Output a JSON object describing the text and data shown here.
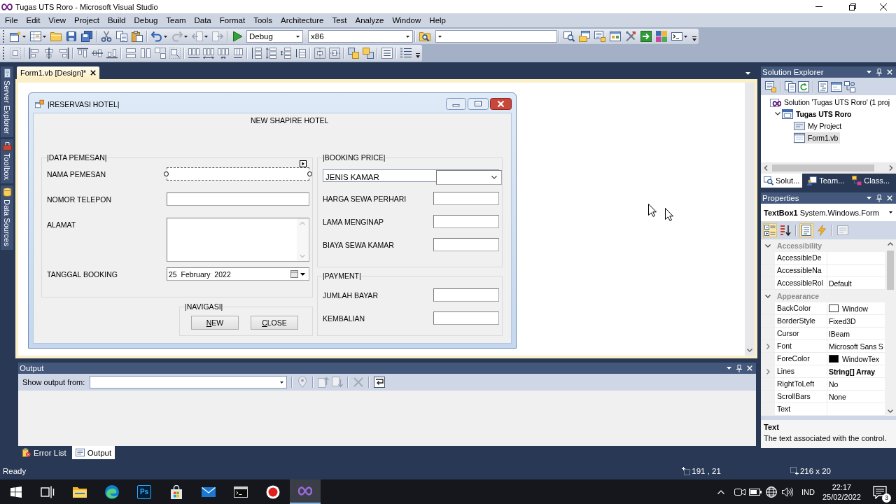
{
  "window": {
    "title": "Tugas UTS Roro - Microsoft Visual Studio"
  },
  "menu": [
    "File",
    "Edit",
    "View",
    "Project",
    "Build",
    "Debug",
    "Team",
    "Data",
    "Format",
    "Tools",
    "Architecture",
    "Test",
    "Analyze",
    "Window",
    "Help"
  ],
  "toolbar": {
    "configuration": "Debug",
    "platform": "x86"
  },
  "side_tabs": [
    "Server Explorer",
    "Toolbox",
    "Data Sources"
  ],
  "document_tabs": [
    {
      "label": "Form1.vb [Design]*",
      "selected": true
    }
  ],
  "form": {
    "title": "|RESERVASI HOTEL|",
    "heading": "NEW SHAPIRE HOTEL",
    "columns": [
      {
        "groups": [
          {
            "title": "|DATA PEMESAN|",
            "fields": [
              {
                "label": "NAMA PEMESAN",
                "kind": "textbox",
                "selected": true
              },
              {
                "label": "NOMOR TELEPON",
                "kind": "textbox",
                "selected": false
              },
              {
                "label": "ALAMAT",
                "kind": "multiline",
                "selected": false
              },
              {
                "label": "TANGGAL BOOKING",
                "kind": "date",
                "value": "25  February  2022",
                "selected": false
              }
            ]
          },
          {
            "title": "|NAVIGASI|",
            "buttons": [
              "NEW",
              "CLOSE"
            ]
          }
        ]
      },
      {
        "groups": [
          {
            "title": "|BOOKING PRICE|",
            "fields": [
              {
                "label": "JENIS KAMAR",
                "kind": "combo",
                "selected": false
              },
              {
                "label": "HARGA SEWA PERHARI",
                "kind": "textbox",
                "selected": false
              },
              {
                "label": "LAMA MENGINAP",
                "kind": "textbox",
                "selected": false
              },
              {
                "label": "BIAYA SEWA KAMAR",
                "kind": "textbox",
                "selected": false
              }
            ]
          },
          {
            "title": "|PAYMENT|",
            "fields": [
              {
                "label": "JUMLAH BAYAR",
                "kind": "textbox",
                "selected": false
              },
              {
                "label": "KEMBALIAN",
                "kind": "textbox",
                "selected": false
              }
            ]
          }
        ]
      }
    ]
  },
  "solution_explorer": {
    "title": "Solution Explorer",
    "tree": [
      {
        "label": "Solution 'Tugas UTS Roro' (1 proj",
        "kind": "solution",
        "selected": false,
        "children": [
          {
            "label": "Tugas UTS Roro",
            "kind": "project",
            "expanded": true,
            "selected": false,
            "children": [
              {
                "label": "My Project",
                "kind": "properties",
                "selected": false
              },
              {
                "label": "Form1.vb",
                "kind": "form",
                "selected": true
              }
            ]
          }
        ]
      }
    ],
    "tabs": [
      {
        "label": "Solut...",
        "kind": "solution",
        "selected": true
      },
      {
        "label": "Team...",
        "kind": "team",
        "selected": false
      },
      {
        "label": "Class...",
        "kind": "class",
        "selected": false
      }
    ]
  },
  "properties": {
    "title": "Properties",
    "object": "**TextBox1** System.Windows.Form",
    "view_buttons": [
      {
        "kind": "categorized",
        "selected": true
      },
      {
        "kind": "alphabetical",
        "selected": false
      },
      {
        "kind": "properties",
        "selected": true
      },
      {
        "kind": "events",
        "selected": false
      }
    ],
    "categories": [
      {
        "name": "Accessibility",
        "expanded": true,
        "rows": [
          {
            "name": "AccessibleDe",
            "expandable": false
          },
          {
            "name": "AccessibleNa",
            "expandable": false
          },
          {
            "name": "AccessibleRol",
            "value": "Default",
            "expandable": false,
            "modified": false
          }
        ]
      },
      {
        "name": "Appearance",
        "expanded": true,
        "rows": [
          {
            "name": "BackColor",
            "value": "Window",
            "color": "#ffffff",
            "expandable": false,
            "modified": false
          },
          {
            "name": "BorderStyle",
            "value": "Fixed3D",
            "expandable": false,
            "modified": false
          },
          {
            "name": "Cursor",
            "value": "IBeam",
            "expandable": false,
            "modified": false
          },
          {
            "name": "Font",
            "value": "Microsoft Sans S",
            "expandable": true,
            "modified": false
          },
          {
            "name": "ForeColor",
            "value": "WindowTex",
            "color": "#000000",
            "expandable": false,
            "modified": false
          },
          {
            "name": "Lines",
            "value": "String[] Array",
            "expandable": true,
            "modified": true
          },
          {
            "name": "RightToLeft",
            "value": "No",
            "expandable": false,
            "modified": false
          },
          {
            "name": "ScrollBars",
            "value": "None",
            "expandable": false,
            "modified": false
          },
          {
            "name": "Text",
            "expandable": false
          }
        ]
      }
    ],
    "description": {
      "title": "Text",
      "text": "The text associated with the control."
    }
  },
  "output": {
    "title": "Output",
    "show_label": "Show output from:"
  },
  "bottom_tabs": [
    {
      "label": "Error List",
      "kind": "errors",
      "selected": false
    },
    {
      "label": "Output",
      "kind": "output",
      "selected": true
    }
  ],
  "status_bar": {
    "text": "Ready",
    "position": "191 , 21",
    "size": "216 x 20"
  },
  "taskbar": {
    "apps": [
      {
        "kind": "task-view",
        "active": false
      },
      {
        "kind": "file-explorer",
        "active": false
      },
      {
        "kind": "browser",
        "active": false
      },
      {
        "kind": "photoshop",
        "label": "Ps",
        "active": false
      },
      {
        "kind": "store",
        "active": false
      },
      {
        "kind": "mail",
        "active": false
      },
      {
        "kind": "terminal",
        "active": false
      },
      {
        "kind": "recorder",
        "active": false
      },
      {
        "kind": "visual-studio",
        "active": true
      }
    ],
    "language": "IND",
    "time": "22:17",
    "date": "25/02/2022",
    "notifications": "3"
  }
}
